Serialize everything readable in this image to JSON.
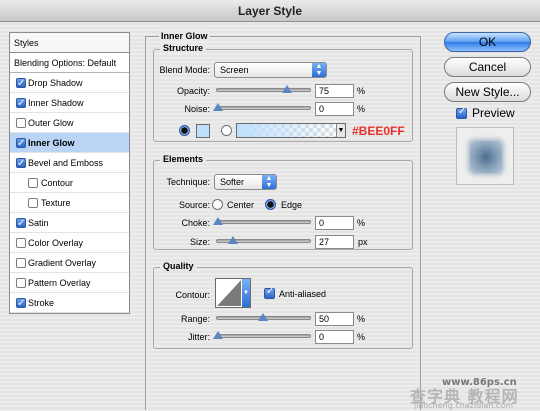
{
  "window": {
    "title": "Layer Style"
  },
  "styles_panel": {
    "header": "Styles",
    "blending_options": "Blending Options: Default",
    "items": [
      {
        "label": "Drop Shadow",
        "checked": true,
        "sub": false,
        "selected": false
      },
      {
        "label": "Inner Shadow",
        "checked": true,
        "sub": false,
        "selected": false
      },
      {
        "label": "Outer Glow",
        "checked": false,
        "sub": false,
        "selected": false
      },
      {
        "label": "Inner Glow",
        "checked": true,
        "sub": false,
        "selected": true
      },
      {
        "label": "Bevel and Emboss",
        "checked": true,
        "sub": false,
        "selected": false
      },
      {
        "label": "Contour",
        "checked": false,
        "sub": true,
        "selected": false
      },
      {
        "label": "Texture",
        "checked": false,
        "sub": true,
        "selected": false
      },
      {
        "label": "Satin",
        "checked": true,
        "sub": false,
        "selected": false
      },
      {
        "label": "Color Overlay",
        "checked": false,
        "sub": false,
        "selected": false
      },
      {
        "label": "Gradient Overlay",
        "checked": false,
        "sub": false,
        "selected": false
      },
      {
        "label": "Pattern Overlay",
        "checked": false,
        "sub": false,
        "selected": false
      },
      {
        "label": "Stroke",
        "checked": true,
        "sub": false,
        "selected": false
      }
    ]
  },
  "inner_glow": {
    "title": "Inner Glow",
    "structure": {
      "title": "Structure",
      "blend_mode_label": "Blend Mode:",
      "blend_mode_value": "Screen",
      "opacity_label": "Opacity:",
      "opacity_value": "75",
      "opacity_unit": "%",
      "noise_label": "Noise:",
      "noise_value": "0",
      "noise_unit": "%",
      "glow_color": "#BEE0FF",
      "color_annotation": "#BEE0FF"
    },
    "elements": {
      "title": "Elements",
      "technique_label": "Technique:",
      "technique_value": "Softer",
      "source_label": "Source:",
      "source_center": "Center",
      "source_edge": "Edge",
      "choke_label": "Choke:",
      "choke_value": "0",
      "choke_unit": "%",
      "size_label": "Size:",
      "size_value": "27",
      "size_unit": "px"
    },
    "quality": {
      "title": "Quality",
      "contour_label": "Contour:",
      "anti_aliased_label": "Anti-aliased",
      "range_label": "Range:",
      "range_value": "50",
      "range_unit": "%",
      "jitter_label": "Jitter:",
      "jitter_value": "0",
      "jitter_unit": "%"
    }
  },
  "buttons": {
    "ok": "OK",
    "cancel": "Cancel",
    "new_style": "New Style...",
    "preview": "Preview"
  },
  "colors": {
    "accent": "#2f7ae6",
    "selection": "#b9d4f4",
    "annotation": "#e8322b"
  },
  "watermark": {
    "text1": "www.86ps.cn",
    "text2": "查字典 教程网",
    "text3": "jiaocheng.chazidian.com"
  }
}
